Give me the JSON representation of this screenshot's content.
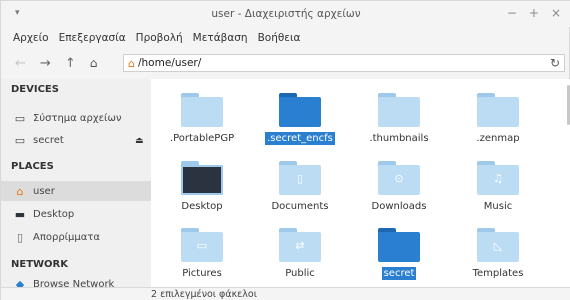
{
  "window": {
    "title": "user - Διαχειριστής αρχείων",
    "menu_arrow": "▾",
    "controls": [
      "−",
      "+",
      "×"
    ]
  },
  "menubar": [
    "Αρχείο",
    "Επεξεργασία",
    "Προβολή",
    "Μετάβαση",
    "Βοήθεια"
  ],
  "toolbar": {
    "back_icon": "←",
    "forward_icon": "→",
    "up_icon": "↑",
    "home_icon": "⌂",
    "path": "/home/user/",
    "reload_icon": "↻"
  },
  "sidebar": {
    "devices_heading": "DEVICES",
    "devices": [
      {
        "label": "Σύστημα αρχείων",
        "icon": "drive-icon"
      },
      {
        "label": "secret",
        "icon": "drive-icon",
        "eject": "⏏"
      }
    ],
    "places_heading": "PLACES",
    "places": [
      {
        "label": "user",
        "icon": "home-icon",
        "selected": true
      },
      {
        "label": "Desktop",
        "icon": "desktop-icon"
      },
      {
        "label": "Απορρίμματα",
        "icon": "trash-icon"
      }
    ],
    "network_heading": "NETWORK",
    "network": [
      {
        "label": "Browse Network",
        "icon": "network-icon"
      }
    ]
  },
  "files": [
    {
      "name": ".PortablePGP",
      "style": "light",
      "selected": false
    },
    {
      "name": ".secret_encfs",
      "style": "dark",
      "selected": true
    },
    {
      "name": ".thumbnails",
      "style": "light",
      "selected": false
    },
    {
      "name": ".zenmap",
      "style": "light",
      "selected": false
    },
    {
      "name": "Desktop",
      "style": "desktop",
      "selected": false
    },
    {
      "name": "Documents",
      "style": "light",
      "glyph": "▯",
      "selected": false
    },
    {
      "name": "Downloads",
      "style": "light",
      "glyph": "⊙",
      "selected": false
    },
    {
      "name": "Music",
      "style": "light",
      "glyph": "♫",
      "selected": false
    },
    {
      "name": "Pictures",
      "style": "light",
      "glyph": "▭",
      "selected": false
    },
    {
      "name": "Public",
      "style": "light",
      "glyph": "⇄",
      "selected": false
    },
    {
      "name": "secret",
      "style": "dark",
      "selected": true
    },
    {
      "name": "Templates",
      "style": "light",
      "glyph": "◺",
      "selected": false
    }
  ],
  "status": "2 επιλεγμένοι φάκελοι",
  "colors": {
    "accent": "#2a7fd1",
    "folder_light": "#bcdcf4",
    "home_orange": "#e27a17"
  }
}
